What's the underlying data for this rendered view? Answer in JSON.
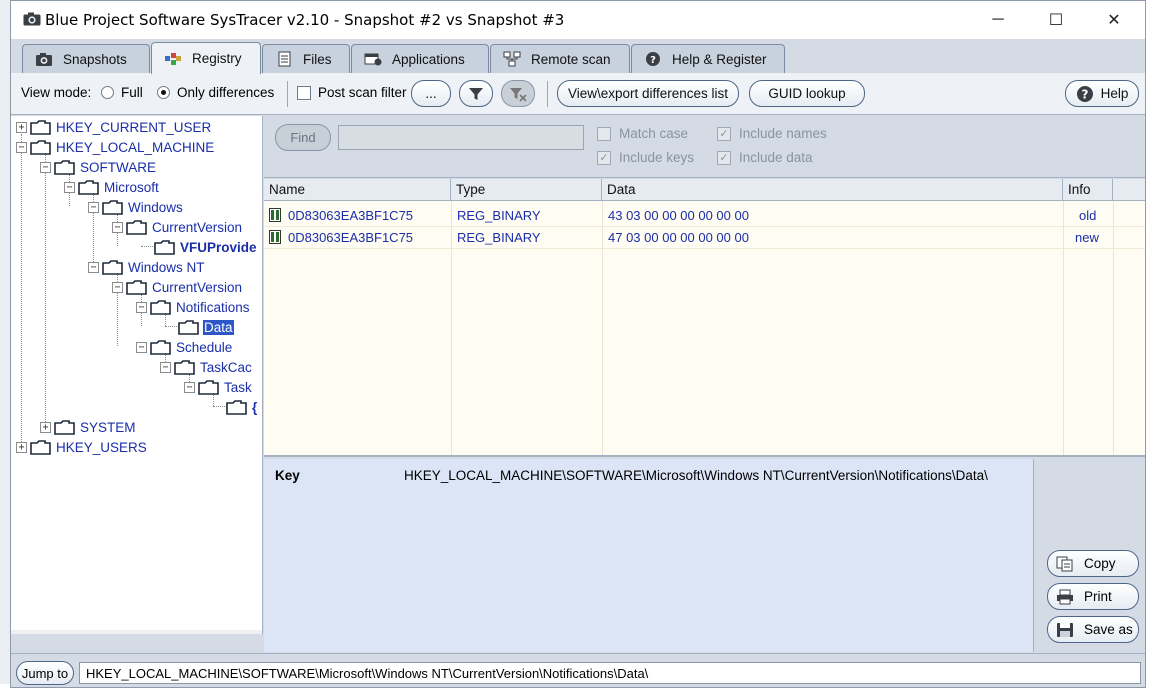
{
  "window": {
    "title": "Blue Project Software SysTracer v2.10 - Snapshot #2 vs Snapshot #3",
    "minimize": "─",
    "maximize": "☐",
    "close": "✕"
  },
  "tabs": [
    {
      "label": "Snapshots",
      "icon": "camera-icon"
    },
    {
      "label": "Registry",
      "icon": "registry-icon",
      "active": true
    },
    {
      "label": "Files",
      "icon": "files-icon"
    },
    {
      "label": "Applications",
      "icon": "applications-icon"
    },
    {
      "label": "Remote scan",
      "icon": "network-icon"
    },
    {
      "label": "Help & Register",
      "icon": "help-icon"
    }
  ],
  "toolbar": {
    "view_mode_label": "View mode:",
    "full_label": "Full",
    "only_diff_label": "Only differences",
    "view_mode_selected": "Only differences",
    "post_scan_filter_label": "Post scan filter",
    "post_scan_filter_checked": false,
    "more_label": "...",
    "view_export_label": "View\\export differences list",
    "guid_lookup_label": "GUID lookup",
    "help_label": "Help"
  },
  "tree": {
    "nodes": [
      {
        "label": "HKEY_CURRENT_USER",
        "expander": "+"
      },
      {
        "label": "HKEY_LOCAL_MACHINE",
        "expander": "−"
      },
      {
        "label": "SOFTWARE",
        "expander": "−"
      },
      {
        "label": "Microsoft",
        "expander": "−"
      },
      {
        "label": "Windows",
        "expander": "−"
      },
      {
        "label": "CurrentVersion",
        "expander": "−"
      },
      {
        "label": "VFUProvide",
        "expander": ""
      },
      {
        "label": "Windows NT",
        "expander": "−"
      },
      {
        "label": "CurrentVersion",
        "expander": "−"
      },
      {
        "label": "Notifications",
        "expander": "−"
      },
      {
        "label": "Data",
        "expander": "",
        "selected": true
      },
      {
        "label": "Schedule",
        "expander": "−"
      },
      {
        "label": "TaskCac",
        "expander": "−"
      },
      {
        "label": "Task",
        "expander": "−"
      },
      {
        "label": "{",
        "expander": ""
      },
      {
        "label": "SYSTEM",
        "expander": "+"
      },
      {
        "label": "HKEY_USERS",
        "expander": "+"
      }
    ],
    "scroll_left": "<",
    "scroll_right": ">"
  },
  "search": {
    "find_label": "Find",
    "find_value": "",
    "match_case_label": "Match case",
    "match_case_checked": false,
    "include_names_label": "Include names",
    "include_names_checked": true,
    "include_keys_label": "Include keys",
    "include_keys_checked": true,
    "include_data_label": "Include data",
    "include_data_checked": true
  },
  "grid": {
    "columns": [
      "Name",
      "Type",
      "Data",
      "Info"
    ],
    "rows": [
      {
        "name": "0D83063EA3BF1C75",
        "type": "REG_BINARY",
        "data": "43 03 00 00 00 00 00 00",
        "info": "old"
      },
      {
        "name": "0D83063EA3BF1C75",
        "type": "REG_BINARY",
        "data": "47 03 00 00 00 00 00 00",
        "info": "new"
      }
    ]
  },
  "details": {
    "key_label": "Key",
    "key_value": "HKEY_LOCAL_MACHINE\\SOFTWARE\\Microsoft\\Windows NT\\CurrentVersion\\Notifications\\Data\\"
  },
  "actions": {
    "copy_label": "Copy",
    "print_label": "Print",
    "save_as_label": "Save as"
  },
  "status": {
    "jump_label": "Jump to",
    "path": "HKEY_LOCAL_MACHINE\\SOFTWARE\\Microsoft\\Windows NT\\CurrentVersion\\Notifications\\Data\\"
  },
  "colors": {
    "tree_text": "#1a2ea8",
    "selection": "#2d56c8",
    "grid_bg": "#fffdf3",
    "details_bg": "#dbe5f5",
    "chrome": "#d4dbe4"
  }
}
